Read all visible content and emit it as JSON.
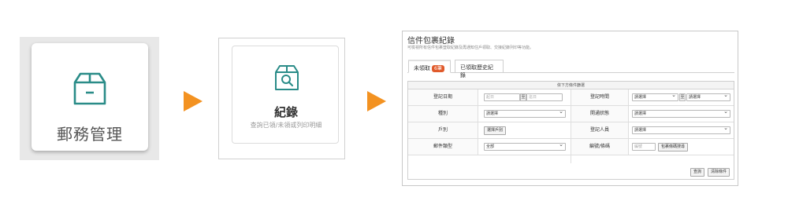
{
  "tile1": {
    "label": "郵務管理",
    "icon": "package-icon"
  },
  "tile2": {
    "title": "紀錄",
    "subtitle": "查詢已領/未領或列印明細",
    "icon": "package-search-icon"
  },
  "page": {
    "title": "信件包裹紀錄",
    "description": "可檢視所有信件包裹登取紀錄及再通知住戶領取、交接紀錄列印等功能。",
    "tabs": [
      {
        "label": "未領取",
        "badge": "6筆"
      },
      {
        "label": "已領取歷史紀錄"
      }
    ],
    "form_header": "依下方條件篩選",
    "fields": {
      "register_date": {
        "label": "登記日期",
        "from_placeholder": "起日",
        "to": "至",
        "to_placeholder": "迄日"
      },
      "register_time": {
        "label": "登記時間",
        "from": "請選擇",
        "to": "至",
        "to_value": "請選擇"
      },
      "category": {
        "label": "種別",
        "value": "請選擇"
      },
      "notice_status": {
        "label": "開通狀態",
        "value": "請選擇"
      },
      "household": {
        "label": "戶別",
        "button": "選擇戶別"
      },
      "registrar": {
        "label": "登記人員",
        "value": "請選擇"
      },
      "mail_type": {
        "label": "郵件類型",
        "value": "全部"
      },
      "tracking_no": {
        "label": "編號/條碼",
        "placeholder": "編號",
        "button": "包裹條碼搜尋"
      }
    },
    "buttons": {
      "search": "查詢",
      "clear": "清除條件"
    }
  },
  "colors": {
    "arrow": "#f39221",
    "teal": "#2a8c88",
    "badge": "#e05a2b"
  }
}
